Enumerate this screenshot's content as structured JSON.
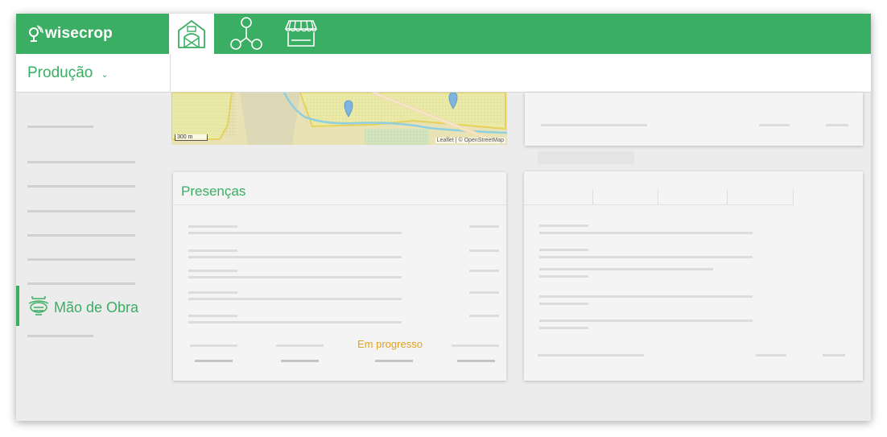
{
  "app": {
    "brand": "wisecrop",
    "colors": {
      "brand_green": "#3aae63",
      "status_in_progress": "#e0a020",
      "background": "#ececec"
    }
  },
  "topnav": {
    "items": [
      {
        "icon": "barn-icon",
        "active": true
      },
      {
        "icon": "network-icon",
        "active": false
      },
      {
        "icon": "market-stall-icon",
        "active": false
      }
    ]
  },
  "module_selector": {
    "value": "Produção",
    "icon": "chevron-down-icon"
  },
  "sidebar": {
    "active_item": {
      "label": "Mão de Obra",
      "icon": "workers-icon"
    }
  },
  "map": {
    "scale_label": "300 m",
    "attribution": "Leaflet | © OpenStreetMap"
  },
  "presencas_card": {
    "title": "Presenças",
    "status": "Em progresso"
  }
}
